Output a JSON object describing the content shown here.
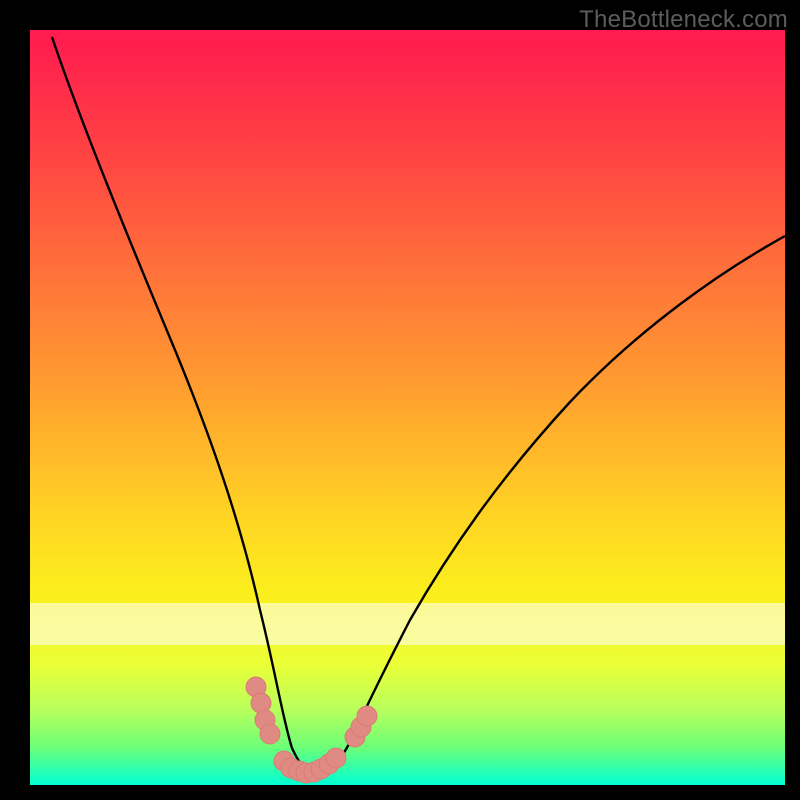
{
  "watermark": "TheBottleneck.com",
  "chart_data": {
    "type": "line",
    "title": "",
    "xlabel": "",
    "ylabel": "",
    "xlim": [
      0,
      100
    ],
    "ylim": [
      0,
      100
    ],
    "series": [
      {
        "name": "bottleneck-curve",
        "x": [
          3,
          6,
          10,
          14,
          18,
          22,
          26,
          29,
          31,
          33,
          34,
          36,
          38,
          41,
          44,
          47,
          52,
          58,
          66,
          75,
          85,
          95,
          100
        ],
        "values": [
          99,
          90,
          79,
          68,
          56,
          44,
          31,
          20,
          13,
          7,
          4,
          2,
          2,
          3,
          6,
          11,
          18,
          27,
          37,
          47,
          56,
          63,
          67
        ]
      }
    ],
    "markers": {
      "name": "salmon-dots",
      "color": "#e08a84",
      "points": [
        {
          "x": 30.0,
          "y": 13.0
        },
        {
          "x": 30.6,
          "y": 10.8
        },
        {
          "x": 31.2,
          "y": 8.6
        },
        {
          "x": 31.8,
          "y": 6.7
        },
        {
          "x": 33.7,
          "y": 3.2
        },
        {
          "x": 34.6,
          "y": 2.3
        },
        {
          "x": 35.6,
          "y": 1.8
        },
        {
          "x": 36.6,
          "y": 1.6
        },
        {
          "x": 37.6,
          "y": 1.7
        },
        {
          "x": 38.6,
          "y": 2.1
        },
        {
          "x": 39.6,
          "y": 2.8
        },
        {
          "x": 40.6,
          "y": 3.6
        },
        {
          "x": 43.0,
          "y": 6.4
        },
        {
          "x": 43.8,
          "y": 7.7
        },
        {
          "x": 44.6,
          "y": 9.2
        }
      ]
    },
    "gradient_stops": [
      {
        "pos": 0.0,
        "color": "#ff1a4f"
      },
      {
        "pos": 0.25,
        "color": "#ff5c3e"
      },
      {
        "pos": 0.5,
        "color": "#ffaa2d"
      },
      {
        "pos": 0.75,
        "color": "#fbef1d"
      },
      {
        "pos": 0.92,
        "color": "#8cff69"
      },
      {
        "pos": 1.0,
        "color": "#00ffd5"
      }
    ],
    "white_band_y": [
      77,
      82
    ]
  }
}
